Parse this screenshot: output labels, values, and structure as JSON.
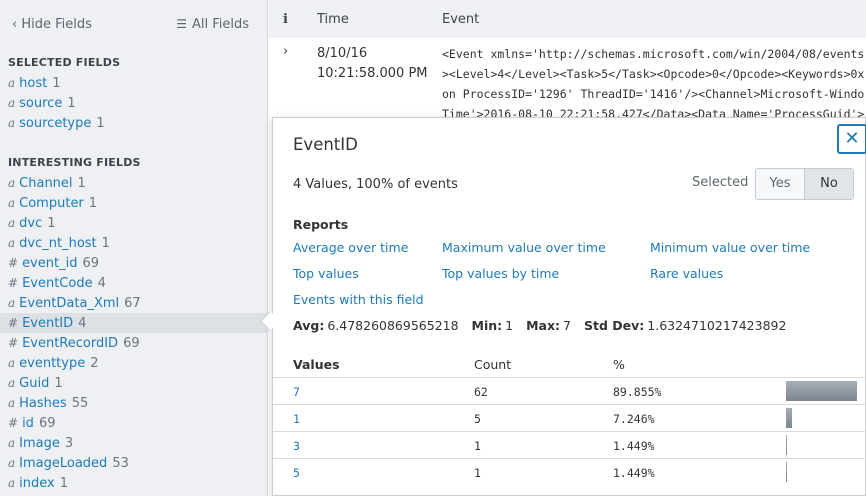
{
  "sidebar": {
    "hide_fields": "Hide Fields",
    "all_fields": "All Fields",
    "selected_title": "SELECTED FIELDS",
    "interesting_title": "INTERESTING FIELDS",
    "selected_fields": [
      {
        "type": "a",
        "name": "host",
        "count": "1"
      },
      {
        "type": "a",
        "name": "source",
        "count": "1"
      },
      {
        "type": "a",
        "name": "sourcetype",
        "count": "1"
      }
    ],
    "interesting_fields": [
      {
        "type": "a",
        "name": "Channel",
        "count": "1"
      },
      {
        "type": "a",
        "name": "Computer",
        "count": "1"
      },
      {
        "type": "a",
        "name": "dvc",
        "count": "1"
      },
      {
        "type": "a",
        "name": "dvc_nt_host",
        "count": "1"
      },
      {
        "type": "#",
        "name": "event_id",
        "count": "69"
      },
      {
        "type": "#",
        "name": "EventCode",
        "count": "4"
      },
      {
        "type": "a",
        "name": "EventData_Xml",
        "count": "67"
      },
      {
        "type": "#",
        "name": "EventID",
        "count": "4"
      },
      {
        "type": "#",
        "name": "EventRecordID",
        "count": "69"
      },
      {
        "type": "a",
        "name": "eventtype",
        "count": "2"
      },
      {
        "type": "a",
        "name": "Guid",
        "count": "1"
      },
      {
        "type": "a",
        "name": "Hashes",
        "count": "55"
      },
      {
        "type": "#",
        "name": "id",
        "count": "69"
      },
      {
        "type": "a",
        "name": "Image",
        "count": "3"
      },
      {
        "type": "a",
        "name": "ImageLoaded",
        "count": "53"
      },
      {
        "type": "a",
        "name": "index",
        "count": "1"
      }
    ]
  },
  "events": {
    "col_info": "i",
    "col_time": "Time",
    "col_event": "Event",
    "row": {
      "date": "8/10/16",
      "time": "10:21:58.000 PM",
      "lines": [
        "<Event xmlns='http://schemas.microsoft.com/win/2004/08/events",
        "><Level>4</Level><Task>5</Task><Opcode>0</Opcode><Keywords>0x",
        "on ProcessID='1296' ThreadID='1416'/><Channel>Microsoft-Windo",
        "Time'>2016-08-10 22:21:58.427</Data><Data Name='ProcessGuid'>"
      ]
    }
  },
  "popover": {
    "title": "EventID",
    "close": "✕",
    "summary": "4 Values, 100% of events",
    "selected_label": "Selected",
    "yes": "Yes",
    "no": "No",
    "reports_title": "Reports",
    "reports": [
      "Average over time",
      "Maximum value over time",
      "Minimum value over time",
      "Top values",
      "Top values by time",
      "Rare values",
      "Events with this field"
    ],
    "stats": {
      "avg_label": "Avg:",
      "avg": "6.478260869565218",
      "min_label": "Min:",
      "min": "1",
      "max_label": "Max:",
      "max": "7",
      "std_label": "Std Dev:",
      "std": "1.6324710217423892"
    },
    "values_header": {
      "values": "Values",
      "count": "Count",
      "pct": "%"
    },
    "values": [
      {
        "value": "7",
        "count": "62",
        "pct": "89.855%",
        "fraction": 0.89855
      },
      {
        "value": "1",
        "count": "5",
        "pct": "7.246%",
        "fraction": 0.07246
      },
      {
        "value": "3",
        "count": "1",
        "pct": "1.449%",
        "fraction": 0.01449
      },
      {
        "value": "5",
        "count": "1",
        "pct": "1.449%",
        "fraction": 0.01449
      }
    ]
  }
}
